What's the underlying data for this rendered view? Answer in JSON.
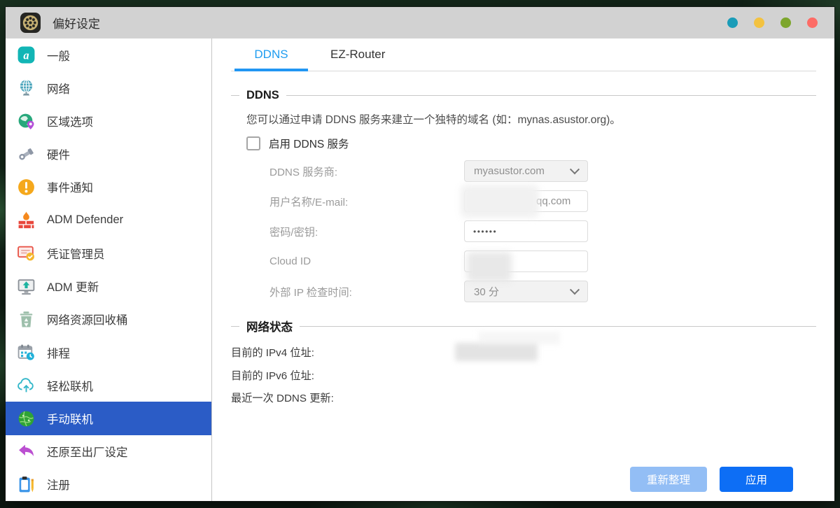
{
  "window": {
    "title": "偏好设定",
    "controls": [
      {
        "name": "control-dot-1",
        "color": "#1a9cb8"
      },
      {
        "name": "control-dot-2",
        "color": "#f3c240"
      },
      {
        "name": "control-dot-3",
        "color": "#7da62c"
      },
      {
        "name": "control-dot-4",
        "color": "#fd6c66"
      }
    ]
  },
  "sidebar": {
    "selected": "手动联机",
    "items": [
      {
        "label": "一般",
        "icon": "asustor-a-icon"
      },
      {
        "label": "网络",
        "icon": "network-globe-icon"
      },
      {
        "label": "区域选项",
        "icon": "region-pin-icon"
      },
      {
        "label": "硬件",
        "icon": "hardware-wrench-icon"
      },
      {
        "label": "事件通知",
        "icon": "alert-icon"
      },
      {
        "label": "ADM Defender",
        "icon": "firewall-icon"
      },
      {
        "label": "凭证管理员",
        "icon": "certificate-icon"
      },
      {
        "label": "ADM 更新",
        "icon": "monitor-update-icon"
      },
      {
        "label": "网络资源回收桶",
        "icon": "recycle-bin-icon"
      },
      {
        "label": "排程",
        "icon": "calendar-clock-icon"
      },
      {
        "label": "轻松联机",
        "icon": "cloud-upload-icon"
      },
      {
        "label": "手动联机",
        "icon": "manual-connect-globe-icon"
      },
      {
        "label": "还原至出厂设定",
        "icon": "undo-arrow-icon"
      },
      {
        "label": "注册",
        "icon": "register-clipboard-icon"
      }
    ]
  },
  "tabs": [
    {
      "label": "DDNS",
      "active": true
    },
    {
      "label": "EZ-Router",
      "active": false
    }
  ],
  "ddns_section": {
    "title": "DDNS",
    "description": "您可以通过申请 DDNS 服务来建立一个独特的域名 (如：mynas.asustor.org)。",
    "enable_checkbox": {
      "label": "启用 DDNS 服务",
      "checked": false
    },
    "provider_label": "DDNS 服务商:",
    "provider_value": "myasustor.com",
    "username_label": "用户名称/E-mail:",
    "username_visible_part": "qq.com",
    "username_redacted": true,
    "password_label": "密码/密钥:",
    "password_masked": "••••••",
    "cloud_id_label": "Cloud ID",
    "cloud_id_redacted": true,
    "interval_label": "外部 IP 检查时间:",
    "interval_value": "30 分"
  },
  "network_status": {
    "title": "网络状态",
    "ipv4_label": "目前的 IPv4 位址:",
    "ipv4_value_redacted": true,
    "ipv6_label": "目前的 IPv6 位址:",
    "ipv6_value": "",
    "last_update_label": "最近一次 DDNS 更新:",
    "last_update_value": ""
  },
  "footer": {
    "refresh_label": "重新整理",
    "refresh_enabled": false,
    "apply_label": "应用"
  },
  "colors": {
    "titlebar_bg": "#d2d2d2",
    "sidebar_selected_bg": "#2b5cc6",
    "active_tab_text": "#1e9cf0",
    "active_tab_underline": "#2196f3",
    "apply_button_bg": "#0d6ef5",
    "refresh_button_bg": "#93bef5"
  }
}
